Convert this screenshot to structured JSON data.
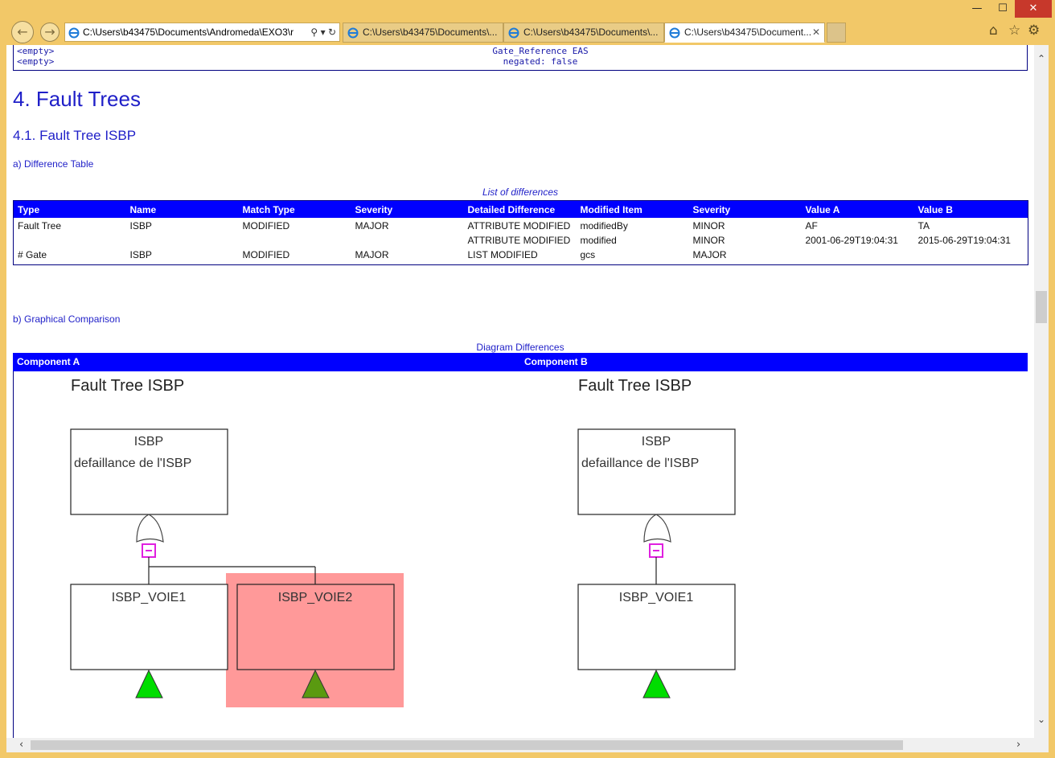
{
  "browser": {
    "address": "C:\\Users\\b43475\\Documents\\Andromeda\\EXO3\\r",
    "tabs": [
      {
        "label": "C:\\Users\\b43475\\Documents\\..."
      },
      {
        "label": "C:\\Users\\b43475\\Documents\\..."
      },
      {
        "label": "C:\\Users\\b43475\\Document..."
      }
    ],
    "window_controls": {
      "minimize": "—",
      "maximize": "☐",
      "close": "✕"
    },
    "icons": [
      "back-icon",
      "forward-icon",
      "search-icon",
      "dropdown-icon",
      "refresh-icon",
      "close-tab-icon",
      "home-icon",
      "favorites-icon",
      "settings-icon"
    ]
  },
  "top_table": {
    "left_rows": [
      "<empty>",
      "<empty>"
    ],
    "right_rows": [
      "Gate_Reference EAS",
      "negated: false"
    ]
  },
  "section": {
    "title": "4. Fault Trees",
    "subtitle": "4.1. Fault Tree ISBP",
    "diff_table_heading": "a) Difference Table",
    "diff_caption": "List of differences",
    "graph_heading": "b) Graphical Comparison",
    "diagram_caption": "Diagram Differences"
  },
  "diff_table": {
    "headers": [
      "Type",
      "Name",
      "Match Type",
      "Severity",
      "Detailed Difference",
      "Modified Item",
      "Severity",
      "Value A",
      "Value B"
    ],
    "rows": [
      [
        "Fault Tree",
        "ISBP",
        "MODIFIED",
        "MAJOR",
        "ATTRIBUTE MODIFIED",
        "modifiedBy",
        "MINOR",
        "AF",
        "TA"
      ],
      [
        "",
        "",
        "",
        "",
        "ATTRIBUTE MODIFIED",
        "modified",
        "MINOR",
        "2001-06-29T19:04:31",
        "2015-06-29T19:04:31"
      ],
      [
        "# Gate",
        "ISBP",
        "MODIFIED",
        "MAJOR",
        "LIST MODIFIED",
        "gcs",
        "MAJOR",
        "",
        ""
      ]
    ]
  },
  "diagram": {
    "headers": [
      "Component A",
      "Component B"
    ],
    "a": {
      "title": "Fault Tree ISBP",
      "top_name": "ISBP",
      "top_desc": "defaillance de l'ISBP",
      "children": [
        "ISBP_VOIE1",
        "ISBP_VOIE2"
      ]
    },
    "b": {
      "title": "Fault Tree ISBP",
      "top_name": "ISBP",
      "top_desc": "defaillance de l'ISBP",
      "children": [
        "ISBP_VOIE1"
      ]
    },
    "colors": {
      "highlight": "#ff9999",
      "event_green": "#00dd00",
      "event_dark": "#5a9a10",
      "gate_marker": "#e020e0"
    }
  }
}
